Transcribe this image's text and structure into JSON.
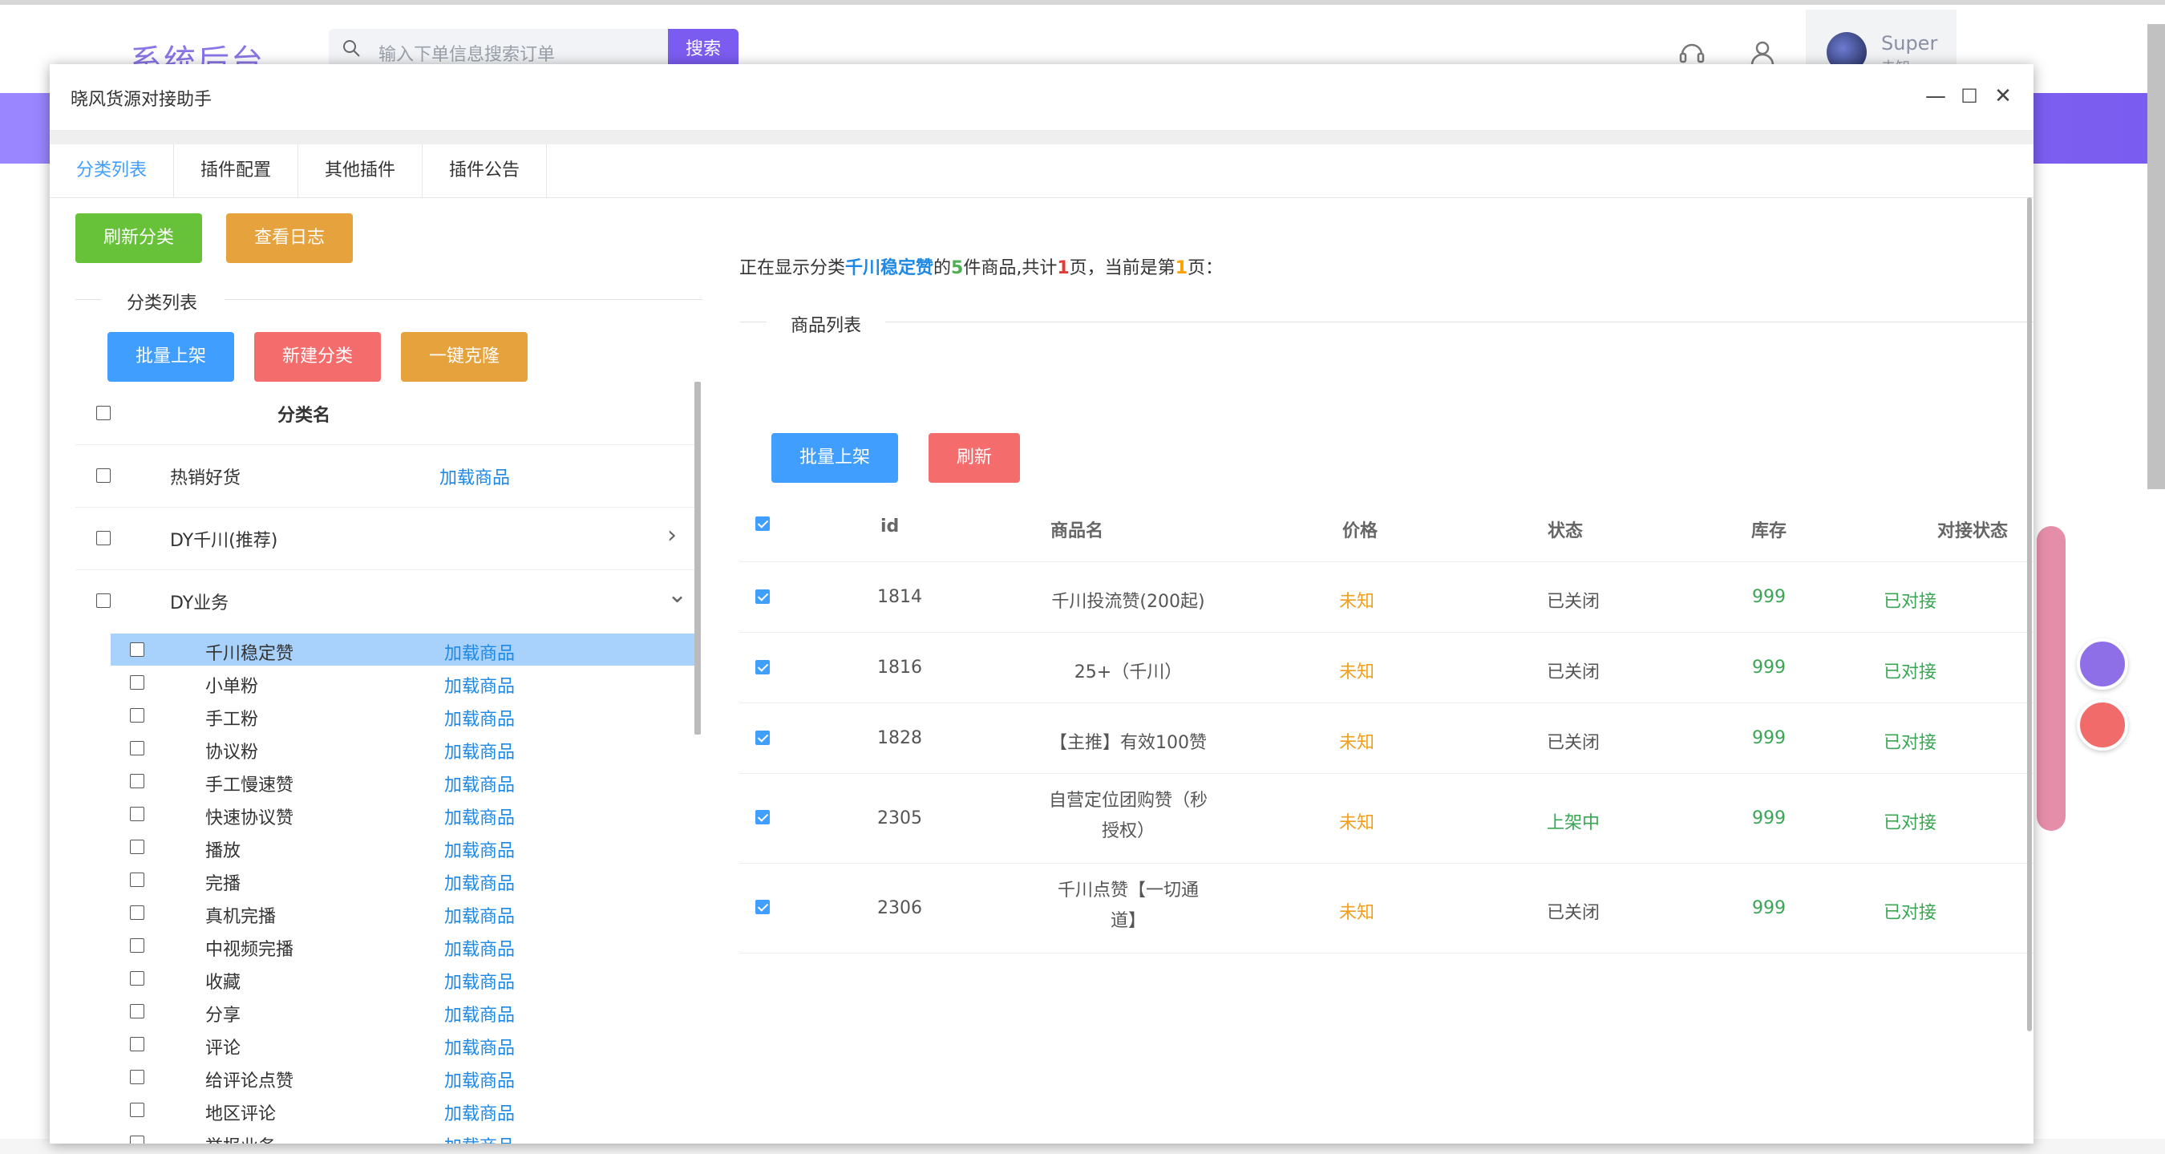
{
  "bg": {
    "logo": "系统后台",
    "search_placeholder": "输入下单信息搜索订单",
    "search_button": "搜索",
    "user_name": "Super",
    "user_sub": "未知"
  },
  "dialog": {
    "title": "晓风货源对接助手",
    "minimize": "—",
    "maximize": "☐",
    "close": "✕"
  },
  "tabs": [
    "分类列表",
    "插件配置",
    "其他插件",
    "插件公告"
  ],
  "toolbar": {
    "refresh_categories": "刷新分类",
    "view_log": "查看日志"
  },
  "categories": {
    "legend": "分类列表",
    "batch_list": "批量上架",
    "new_category": "新建分类",
    "one_key_clone": "一键克隆",
    "header_name": "分类名",
    "load_label": "加载商品",
    "top_items": [
      {
        "name": "热销好货",
        "action": "加载商品"
      },
      {
        "name": "DY千川(推荐)",
        "expand": "›"
      },
      {
        "name": "DY业务",
        "expand": "⌄"
      }
    ],
    "sub_items": [
      "千川稳定赞",
      "小单粉",
      "手工粉",
      "协议粉",
      "手工慢速赞",
      "快速协议赞",
      "播放",
      "完播",
      "真机完播",
      "中视频完播",
      "收藏",
      "分享",
      "评论",
      "给评论点赞",
      "地区评论",
      "举报业务"
    ]
  },
  "status": {
    "prefix": "正在显示分类",
    "category": "千川稳定赞",
    "mid1": "的",
    "count": "5",
    "mid2": "件商品,共计",
    "pages": "1",
    "mid3": "页，当前是第",
    "current": "1",
    "suffix": "页："
  },
  "goods": {
    "legend": "商品列表",
    "batch_list": "批量上架",
    "refresh": "刷新",
    "headers": [
      "id",
      "商品名",
      "价格",
      "状态",
      "库存",
      "对接状态"
    ],
    "rows": [
      {
        "id": "1814",
        "name": "千川投流赞(200起)",
        "price": "未知",
        "status": "已关闭",
        "stock": "999",
        "link": "已对接"
      },
      {
        "id": "1816",
        "name": "25+（千川）",
        "price": "未知",
        "status": "已关闭",
        "stock": "999",
        "link": "已对接"
      },
      {
        "id": "1828",
        "name": "【主推】有效100赞",
        "price": "未知",
        "status": "已关闭",
        "stock": "999",
        "link": "已对接"
      },
      {
        "id": "2305",
        "name": "自营定位团购赞（秒授权）",
        "name_l1": "自营定位团购赞（秒",
        "name_l2": "授权）",
        "price": "未知",
        "status": "上架中",
        "stock": "999",
        "link": "已对接"
      },
      {
        "id": "2306",
        "name": "千川点赞【一切通道】",
        "name_l1": "千川点赞【一切通",
        "name_l2": "道】",
        "price": "未知",
        "status": "已关闭",
        "stock": "999",
        "link": "已对接"
      }
    ]
  }
}
